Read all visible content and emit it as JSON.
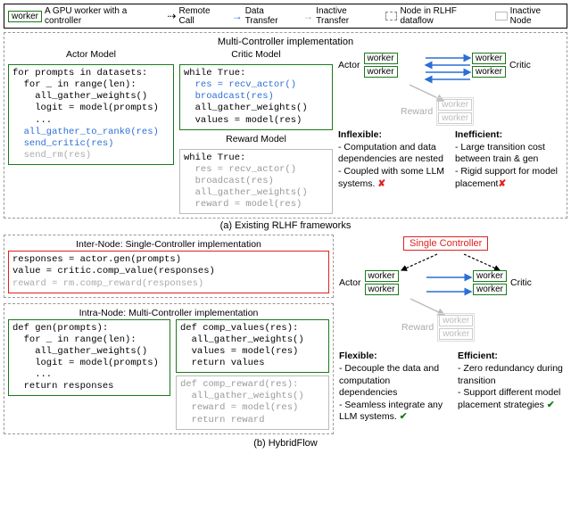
{
  "legend": {
    "worker_box": "worker",
    "worker_desc": "A GPU worker with a controller",
    "remote_call": "Remote Call",
    "data_transfer": "Data Transfer",
    "inactive_transfer": "Inactive Transfer",
    "node_dataflow": "Node in RLHF dataflow",
    "inactive_node": "Inactive Node"
  },
  "a": {
    "panel_title": "Multi-Controller implementation",
    "actor_label": "Actor Model",
    "actor_code": {
      "l1": "for prompts in datasets:",
      "l2": "  for _ in range(len):",
      "l3": "    all_gather_weights()",
      "l4": "    logit = model(prompts)",
      "l5": "    ...",
      "l6": "  all_gather_to_rank0(res)",
      "l7": "  send_critic(res)",
      "l8": "  send_rm(res)"
    },
    "critic_label": "Critic Model",
    "critic_code": {
      "l1": "while True:",
      "l2": "  res = recv_actor()",
      "l3": "  broadcast(res)",
      "l4": "  all_gather_weights()",
      "l5": "  values = model(res)"
    },
    "reward_label": "Reward Model",
    "reward_code": {
      "l1": "while True:",
      "l2": "  res = recv_actor()",
      "l3": "  broadcast(res)",
      "l4": "  all_gather_weights()",
      "l5": "  reward = model(res)"
    },
    "net": {
      "actor": "Actor",
      "critic": "Critic",
      "reward": "Reward",
      "worker": "worker"
    },
    "analysis": {
      "inflexible_h": "Inflexible:",
      "inflexible_b1": "- Computation and data dependencies are nested",
      "inflexible_b2": "- Coupled with some LLM systems.",
      "inefficient_h": "Inefficient:",
      "inefficient_b1": "- Large transition cost between train & gen",
      "inefficient_b2": "- Rigid support for model placement"
    },
    "caption": "(a) Existing RLHF frameworks"
  },
  "b": {
    "inter_title": "Inter-Node: Single-Controller implementation",
    "inter_code": {
      "l1": "responses = actor.gen(prompts)",
      "l2": "value = critic.comp_value(responses)",
      "l3": "reward = rm.comp_reward(responses)"
    },
    "intra_title": "Intra-Node: Multi-Controller implementation",
    "gen_code": {
      "l1": "def gen(prompts):",
      "l2": "  for _ in range(len):",
      "l3": "    all_gather_weights()",
      "l4": "    logit = model(prompts)",
      "l5": "    ...",
      "l6": "  return responses"
    },
    "cv_code": {
      "l1": "def comp_values(res):",
      "l2": "  all_gather_weights()",
      "l3": "  values = model(res)",
      "l4": "  return values"
    },
    "cr_code": {
      "l1": "def comp_reward(res):",
      "l2": "  all_gather_weights()",
      "l3": "  reward = model(res)",
      "l4": "  return reward"
    },
    "net": {
      "single_controller": "Single Controller",
      "actor": "Actor",
      "critic": "Critic",
      "reward": "Reward",
      "worker": "worker"
    },
    "analysis": {
      "flexible_h": "Flexible:",
      "flexible_b1": "- Decouple the data and computation dependencies",
      "flexible_b2": "- Seamless integrate any LLM systems.",
      "efficient_h": "Efficient:",
      "efficient_b1": "- Zero redundancy during transition",
      "efficient_b2": "- Support different model placement strategies"
    },
    "caption": "(b) HybridFlow"
  }
}
